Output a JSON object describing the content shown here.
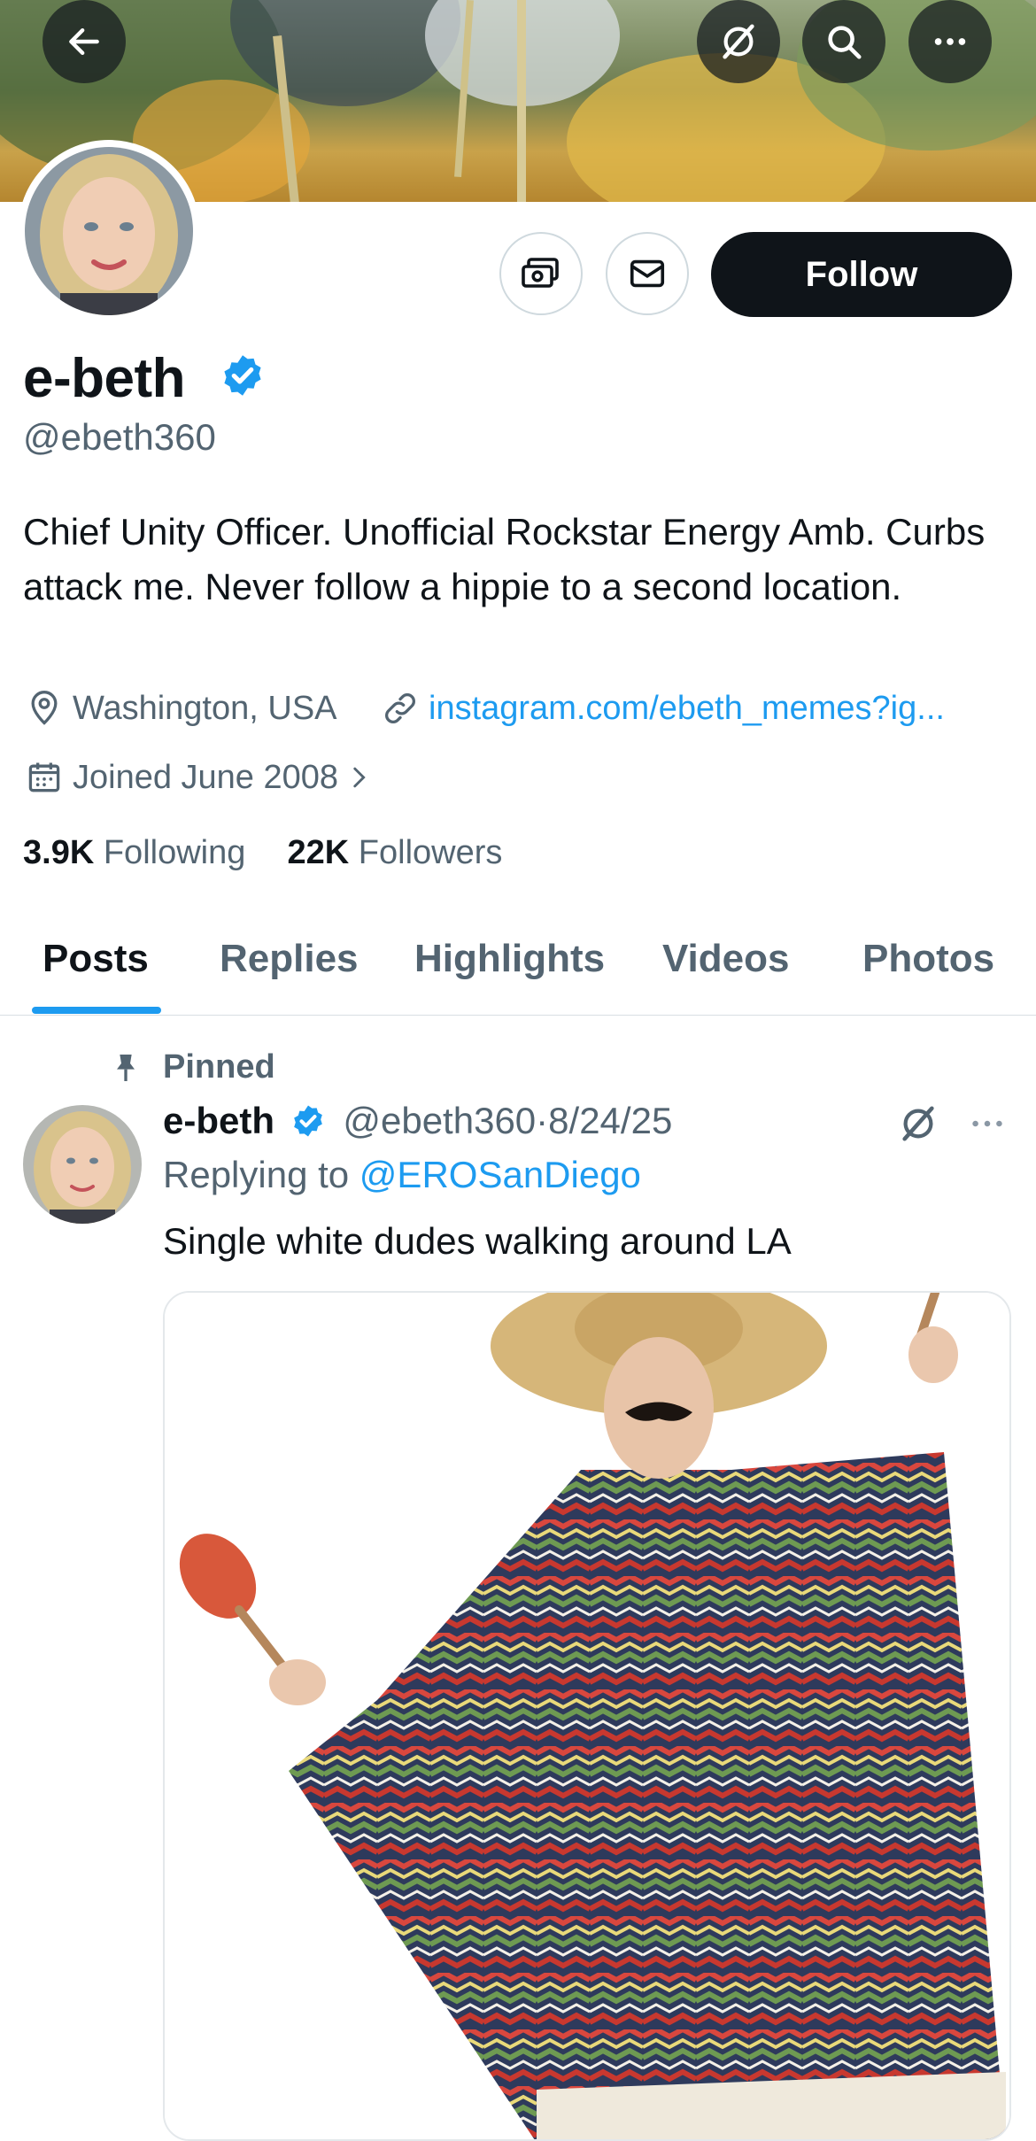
{
  "header": {
    "back_icon": "arrow-left-icon",
    "grok_icon": "grok-icon",
    "search_icon": "search-icon",
    "more_icon": "more-horizontal-icon"
  },
  "profile": {
    "name": "e-beth",
    "handle": "@ebeth360",
    "verified": true,
    "follow_label": "Follow",
    "bio": "Chief Unity Officer. Unofficial Rockstar Energy Amb. Curbs attack me. Never follow a hippie to a second location.",
    "location": "Washington, USA",
    "website": "instagram.com/ebeth_memes?ig...",
    "joined": "Joined June 2008",
    "following_count": "3.9K",
    "following_label": "Following",
    "followers_count": "22K",
    "followers_label": "Followers"
  },
  "tabs": [
    {
      "label": "Posts",
      "active": true
    },
    {
      "label": "Replies",
      "active": false
    },
    {
      "label": "Highlights",
      "active": false
    },
    {
      "label": "Videos",
      "active": false
    },
    {
      "label": "Photos",
      "active": false
    }
  ],
  "post": {
    "pinned_label": "Pinned",
    "author_name": "e-beth",
    "author_handle": "@ebeth360",
    "separator": "·",
    "date": "8/24/25",
    "replying_prefix": "Replying to",
    "replying_to": "@EROSanDiego",
    "text": "Single white dudes walking around LA"
  },
  "colors": {
    "accent": "#1d9bf0",
    "text": "#0f1419",
    "secondary": "#536471",
    "follow_button": "#0f1419"
  }
}
